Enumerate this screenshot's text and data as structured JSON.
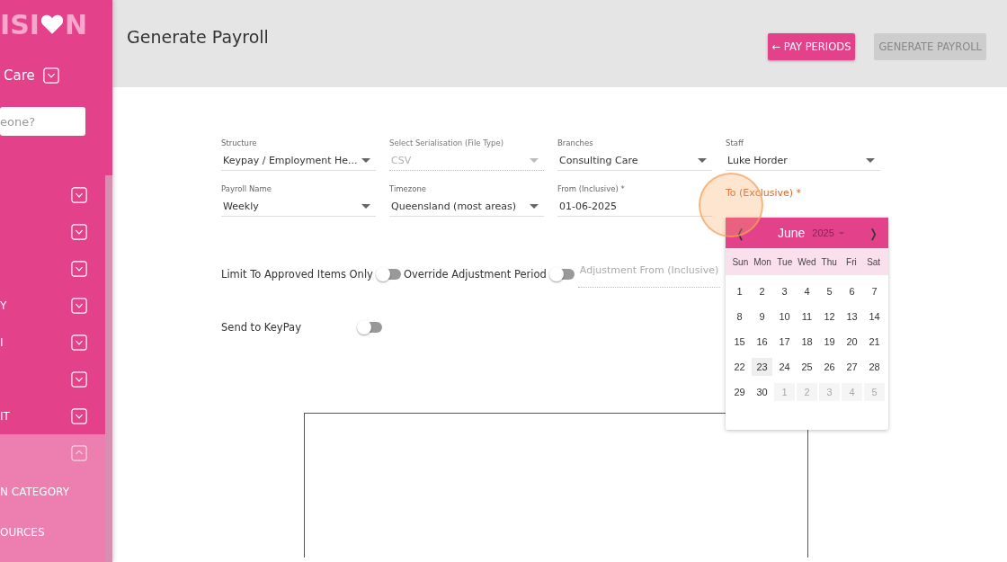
{
  "sidebar": {
    "logo": {
      "text_before": "ISI",
      "text_after": "N"
    },
    "branch": "Care",
    "search": {
      "placeholder": "eone?"
    },
    "items": [
      {
        "expanded": false
      },
      {
        "expanded": false
      },
      {
        "expanded": false
      },
      {
        "label": "Y",
        "expanded": false
      },
      {
        "label": "I",
        "expanded": false
      },
      {
        "expanded": false
      },
      {
        "label": "IT",
        "expanded": false
      },
      {
        "expanded": true,
        "children": [
          {
            "label": "N CATEGORY"
          },
          {
            "label": "OURCES"
          }
        ]
      }
    ]
  },
  "header": {
    "title": "Generate Payroll",
    "buttons": [
      {
        "label": "← PAY PERIODS",
        "disabled": false
      },
      {
        "label": "GENERATE PAYROLL",
        "disabled": true
      }
    ]
  },
  "field_rows": [
    [
      {
        "label": "Structure",
        "value": "Keypay / Employment He...",
        "kind": "select",
        "disabled": false,
        "focused": false
      },
      {
        "label": "Select Serialisation (File Type)",
        "value": "CSV",
        "kind": "select",
        "disabled": true,
        "focused": false
      },
      {
        "label": "Branches",
        "value": "Consulting Care",
        "kind": "select",
        "disabled": false,
        "focused": false
      },
      {
        "label": "Staff",
        "value": "Luke Horder",
        "kind": "select",
        "disabled": false,
        "focused": false
      }
    ],
    [
      {
        "label": "Payroll Name",
        "value": "Weekly",
        "kind": "select",
        "disabled": false,
        "focused": false
      },
      {
        "label": "Timezone",
        "value": "Queensland (most areas)",
        "kind": "select",
        "disabled": false,
        "focused": false
      },
      {
        "label": "From (Inclusive) *",
        "value": "01-06-2025",
        "kind": "date",
        "disabled": false,
        "focused": false
      },
      {
        "label": "To (Exclusive) *",
        "kind": "date",
        "disabled": false,
        "focused": true
      }
    ]
  ],
  "toggles": [
    {
      "label": "Limit To Approved Items Only",
      "on": false
    },
    {
      "label": "Override Adjustment Period",
      "on": false
    }
  ],
  "adjustment_field": {
    "placeholder": "Adjustment From (Inclusive)",
    "disabled": true
  },
  "send_toggle": {
    "label": "Send to KeyPay",
    "on": false
  },
  "calendar": {
    "prev": "❬",
    "next": "❭",
    "month": "June",
    "year": "2025",
    "weekdays": [
      "Sun",
      "Mon",
      "Tue",
      "Wed",
      "Thu",
      "Fri",
      "Sat"
    ],
    "weeks": [
      [
        {
          "day": "1",
          "outside": false,
          "today": false
        },
        {
          "day": "2",
          "outside": false,
          "today": false
        },
        {
          "day": "3",
          "outside": false,
          "today": false
        },
        {
          "day": "4",
          "outside": false,
          "today": false
        },
        {
          "day": "5",
          "outside": false,
          "today": false
        },
        {
          "day": "6",
          "outside": false,
          "today": false
        },
        {
          "day": "7",
          "outside": false,
          "today": false
        }
      ],
      [
        {
          "day": "8",
          "outside": false,
          "today": false
        },
        {
          "day": "9",
          "outside": false,
          "today": false
        },
        {
          "day": "10",
          "outside": false,
          "today": false
        },
        {
          "day": "11",
          "outside": false,
          "today": false
        },
        {
          "day": "12",
          "outside": false,
          "today": false
        },
        {
          "day": "13",
          "outside": false,
          "today": false
        },
        {
          "day": "14",
          "outside": false,
          "today": false
        }
      ],
      [
        {
          "day": "15",
          "outside": false,
          "today": false
        },
        {
          "day": "16",
          "outside": false,
          "today": false
        },
        {
          "day": "17",
          "outside": false,
          "today": false
        },
        {
          "day": "18",
          "outside": false,
          "today": false
        },
        {
          "day": "19",
          "outside": false,
          "today": false
        },
        {
          "day": "20",
          "outside": false,
          "today": false
        },
        {
          "day": "21",
          "outside": false,
          "today": false
        }
      ],
      [
        {
          "day": "22",
          "outside": false,
          "today": false
        },
        {
          "day": "23",
          "outside": false,
          "today": true
        },
        {
          "day": "24",
          "outside": false,
          "today": false
        },
        {
          "day": "25",
          "outside": false,
          "today": false
        },
        {
          "day": "26",
          "outside": false,
          "today": false
        },
        {
          "day": "27",
          "outside": false,
          "today": false
        },
        {
          "day": "28",
          "outside": false,
          "today": false
        }
      ],
      [
        {
          "day": "29",
          "outside": false,
          "today": false
        },
        {
          "day": "30",
          "outside": false,
          "today": false
        },
        {
          "day": "1",
          "outside": true,
          "today": false
        },
        {
          "day": "2",
          "outside": true,
          "today": false
        },
        {
          "day": "3",
          "outside": true,
          "today": false
        },
        {
          "day": "4",
          "outside": true,
          "today": false
        },
        {
          "day": "5",
          "outside": true,
          "today": false
        }
      ]
    ]
  }
}
